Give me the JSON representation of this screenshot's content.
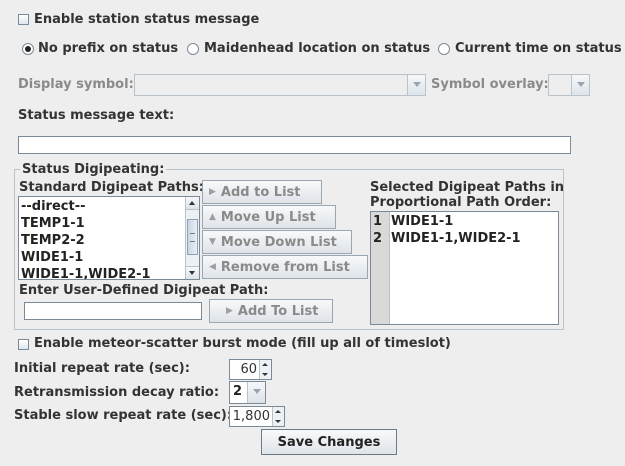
{
  "enable_status": {
    "label": "Enable station status message",
    "checked": false
  },
  "prefix_options": [
    {
      "label": "No prefix on status",
      "selected": true
    },
    {
      "label": "Maidenhead location on status",
      "selected": false
    },
    {
      "label": "Current time on status",
      "selected": false
    }
  ],
  "display_symbol": {
    "label": "Display symbol:",
    "value": ""
  },
  "symbol_overlay": {
    "label": "Symbol overlay:",
    "value": ""
  },
  "status_text": {
    "label": "Status message text:",
    "value": ""
  },
  "digipeating": {
    "group_title": "Status Digipeating:",
    "standard_label": "Standard Digipeat Paths:",
    "standard_paths": [
      "--direct--",
      "TEMP1-1",
      "TEMP2-2",
      "WIDE1-1",
      "WIDE1-1,WIDE2-1"
    ],
    "buttons": {
      "add": "Add to List",
      "move_up": "Move Up List",
      "move_down": "Move Down List",
      "remove": "Remove from List",
      "add_user": "Add To List"
    },
    "selected_label_line1": "Selected Digipeat Paths in",
    "selected_label_line2": "Proportional Path Order:",
    "selected_paths": [
      {
        "num": "1",
        "path": "WIDE1-1"
      },
      {
        "num": "2",
        "path": "WIDE1-1,WIDE2-1"
      }
    ],
    "user_defined_label": "Enter User-Defined Digipeat Path:",
    "user_defined_value": ""
  },
  "meteor_scatter": {
    "label": "Enable meteor-scatter burst mode (fill up all of timeslot)",
    "checked": false
  },
  "initial_repeat": {
    "label": "Initial repeat rate (sec):",
    "value": "60"
  },
  "decay_ratio": {
    "label": "Retransmission decay ratio:",
    "value": "2"
  },
  "slow_repeat": {
    "label": "Stable slow repeat rate (sec):",
    "value": "1,800"
  },
  "save_button": "Save Changes",
  "icons": {
    "button_arrow": "triangle-right-icon",
    "combo": "chevron-down-icon"
  }
}
